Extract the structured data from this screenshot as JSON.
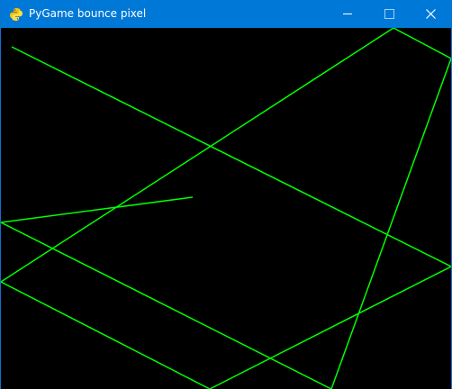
{
  "window": {
    "title": "PyGame bounce pixel",
    "app_icon": "pygame-snake-icon",
    "controls": {
      "minimize_icon": "minimize-icon",
      "maximize_icon": "maximize-icon",
      "close_icon": "close-icon"
    }
  },
  "canvas": {
    "background": "#000000",
    "line_color": "#00ff00",
    "trail": "single bouncing green pixel trail drawn as connected line segments"
  },
  "colors": {
    "titlebar": "#0078d7",
    "title_text": "#ffffff",
    "line": "#00ff00"
  }
}
